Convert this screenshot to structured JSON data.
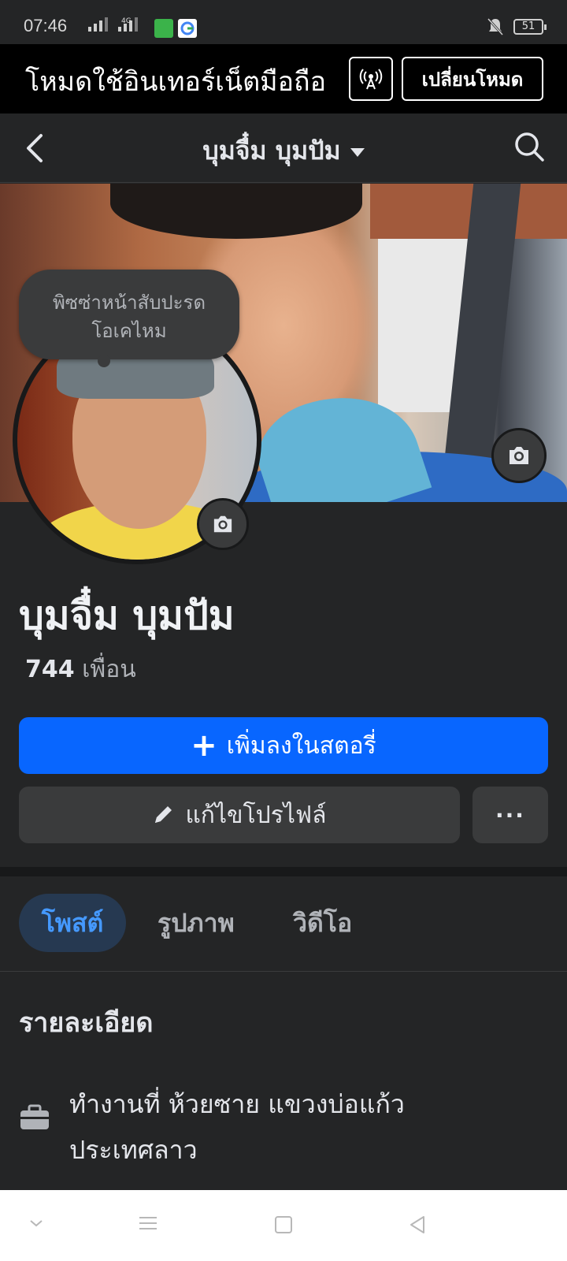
{
  "status_bar": {
    "time": "07:46",
    "network": "4G",
    "battery": "51"
  },
  "banner": {
    "text": "โหมดใช้อินเทอร์เน็ตมือถือ",
    "button_label": "เปลี่ยนโหมด"
  },
  "navbar": {
    "title": "บุมจื๋ม บุมปัม"
  },
  "profile": {
    "note_line1": "พิซซ่าหน้าสับปะรด",
    "note_line2": "โอเคไหม",
    "name": "บุมจื๋ม บุมปัม",
    "friends_count": "744",
    "friends_label": "เพื่อน"
  },
  "actions": {
    "add_story": "เพิ่มลงในสตอรี่",
    "edit_profile": "แก้ไขโปรไฟล์",
    "more": "···"
  },
  "tabs": [
    {
      "label": "โพสต์",
      "active": true
    },
    {
      "label": "รูปภาพ",
      "active": false
    },
    {
      "label": "วิดีโอ",
      "active": false
    }
  ],
  "details": {
    "heading": "รายละเอียด",
    "work_line1": "ทำงานที่ ห้วยซาย แขวงบ่อแก้ว",
    "work_line2": "ประเทศลาว"
  },
  "colors": {
    "accent": "#0866ff",
    "tab_active_text": "#4599ff",
    "background": "#242526"
  },
  "icons": [
    "signal-icon",
    "wechat-icon",
    "google-icon",
    "bell-off-icon",
    "battery-icon",
    "hotspot-icon",
    "back-arrow-icon",
    "search-icon",
    "camera-icon",
    "plus-icon",
    "pencil-icon",
    "briefcase-icon"
  ]
}
